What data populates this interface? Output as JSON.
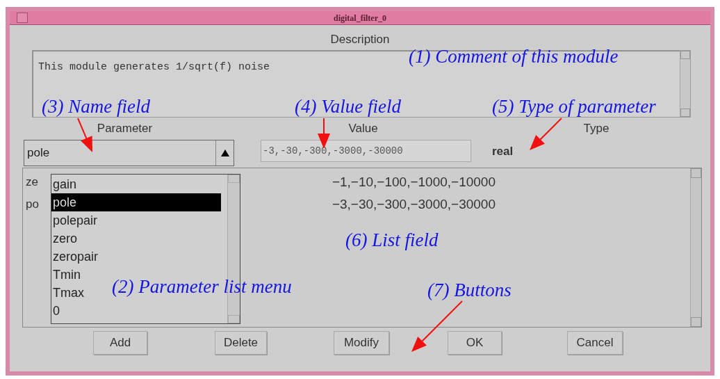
{
  "window": {
    "title": "digital_filter_0"
  },
  "description": {
    "label": "Description",
    "text": "This module generates 1/sqrt(f) noise"
  },
  "columns": [
    "Parameter",
    "Value",
    "Type"
  ],
  "name_field": {
    "value": "pole"
  },
  "value_field": {
    "value": "-3,-30,-300,-3000,-30000"
  },
  "type": "real",
  "list_rows": [
    {
      "name": "ze",
      "value": "−1,−10,−100,−1000,−10000"
    },
    {
      "name": "po",
      "value": "−3,−30,−300,−3000,−30000"
    }
  ],
  "parameter_menu": [
    {
      "label": "gain",
      "selected": false
    },
    {
      "label": "pole",
      "selected": true
    },
    {
      "label": "polepair",
      "selected": false
    },
    {
      "label": "zero",
      "selected": false
    },
    {
      "label": "zeropair",
      "selected": false
    },
    {
      "label": "Tmin",
      "selected": false
    },
    {
      "label": "Tmax",
      "selected": false
    },
    {
      "label": "0",
      "selected": false
    }
  ],
  "buttons": [
    "Add",
    "Delete",
    "Modify",
    "OK",
    "Cancel"
  ],
  "annotations": [
    {
      "text": "(1) Comment of this module"
    },
    {
      "text": "(3) Name field"
    },
    {
      "text": "(4) Value field"
    },
    {
      "text": "(5) Type of parameter"
    },
    {
      "text": "(6) List field"
    },
    {
      "text": "(2) Parameter list menu"
    },
    {
      "text": "(7) Buttons"
    }
  ]
}
